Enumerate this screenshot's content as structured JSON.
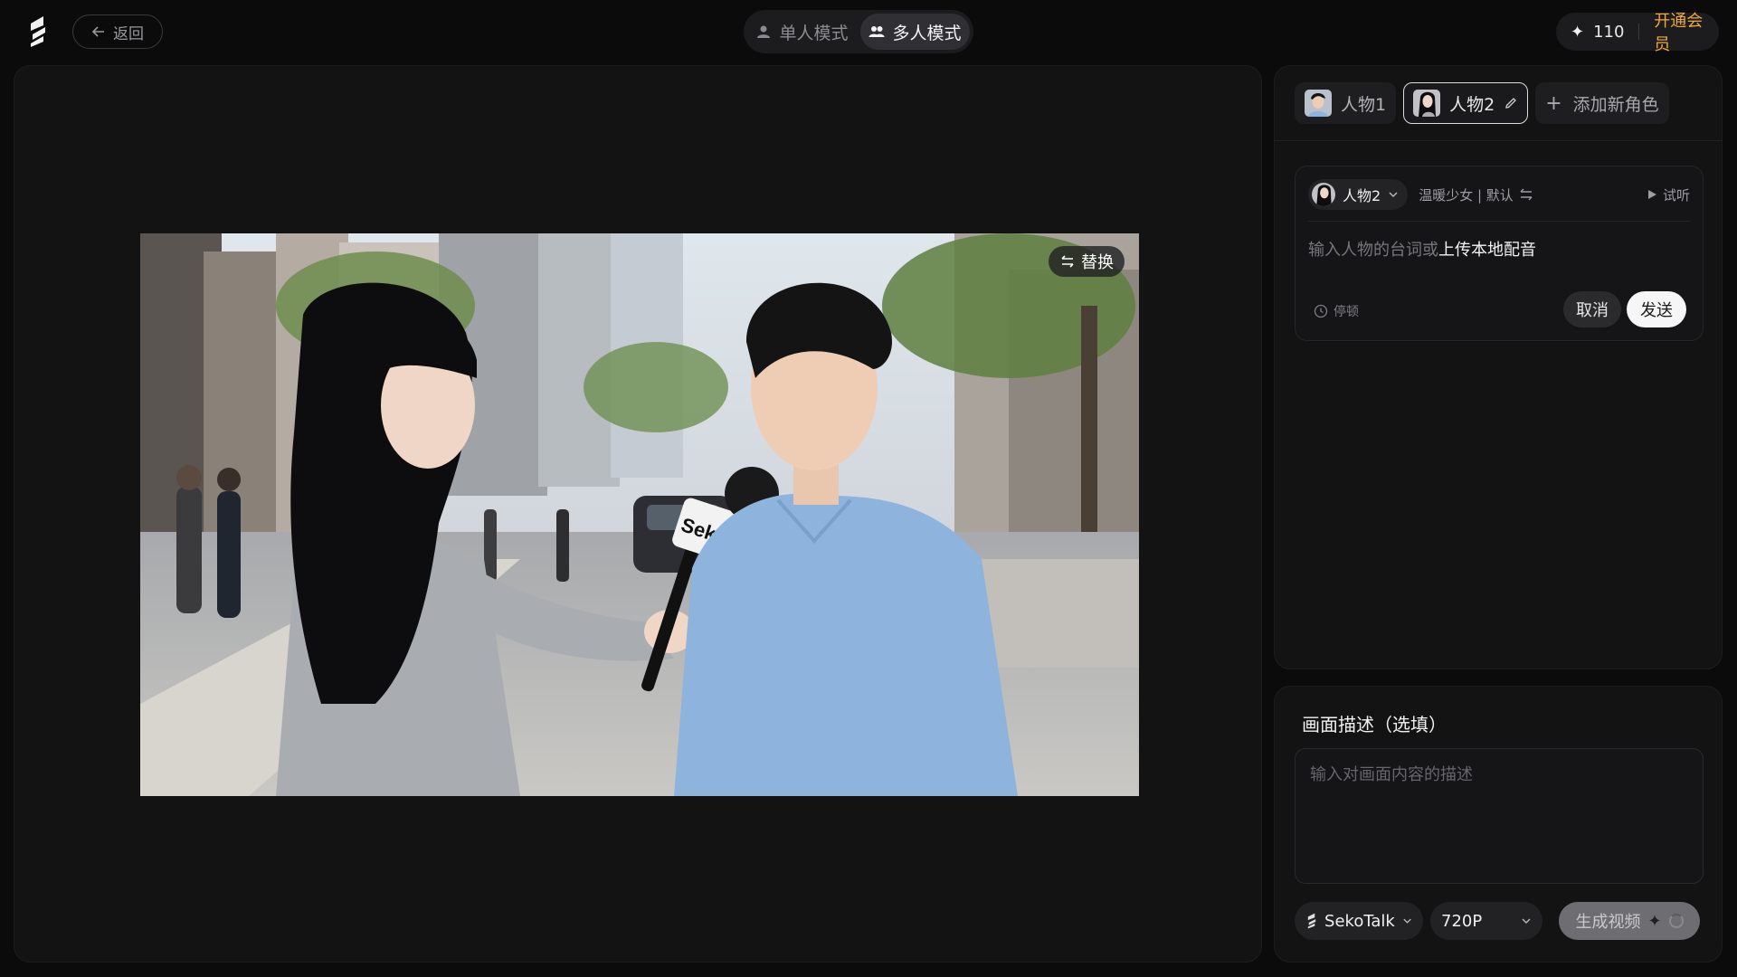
{
  "header": {
    "back_label": "返回",
    "modes": [
      {
        "label": "单人模式",
        "active": false
      },
      {
        "label": "多人模式",
        "active": true
      }
    ],
    "credits": "110",
    "vip_label": "开通会员"
  },
  "canvas": {
    "replace_label": "替换",
    "mic_brand": "Seko TV"
  },
  "characters": {
    "tabs": [
      {
        "label": "人物1",
        "active": false
      },
      {
        "label": "人物2",
        "active": true
      }
    ],
    "add_label": "添加新角色"
  },
  "dialog": {
    "speaker": "人物2",
    "voice": "温暖少女 | 默认",
    "listen_label": "试听",
    "input_placeholder": "输入人物的台词或",
    "upload_label": "上传本地配音",
    "pause_label": "停顿",
    "cancel_label": "取消",
    "send_label": "发送"
  },
  "description": {
    "title": "画面描述（选填）",
    "placeholder": "输入对画面内容的描述"
  },
  "footer": {
    "model": "SekoTalk",
    "resolution": "720P",
    "generate_label": "生成视频"
  },
  "colors": {
    "accent_vip": "#f0a93c",
    "background": "#0b0b0c",
    "panel": "#131314"
  }
}
